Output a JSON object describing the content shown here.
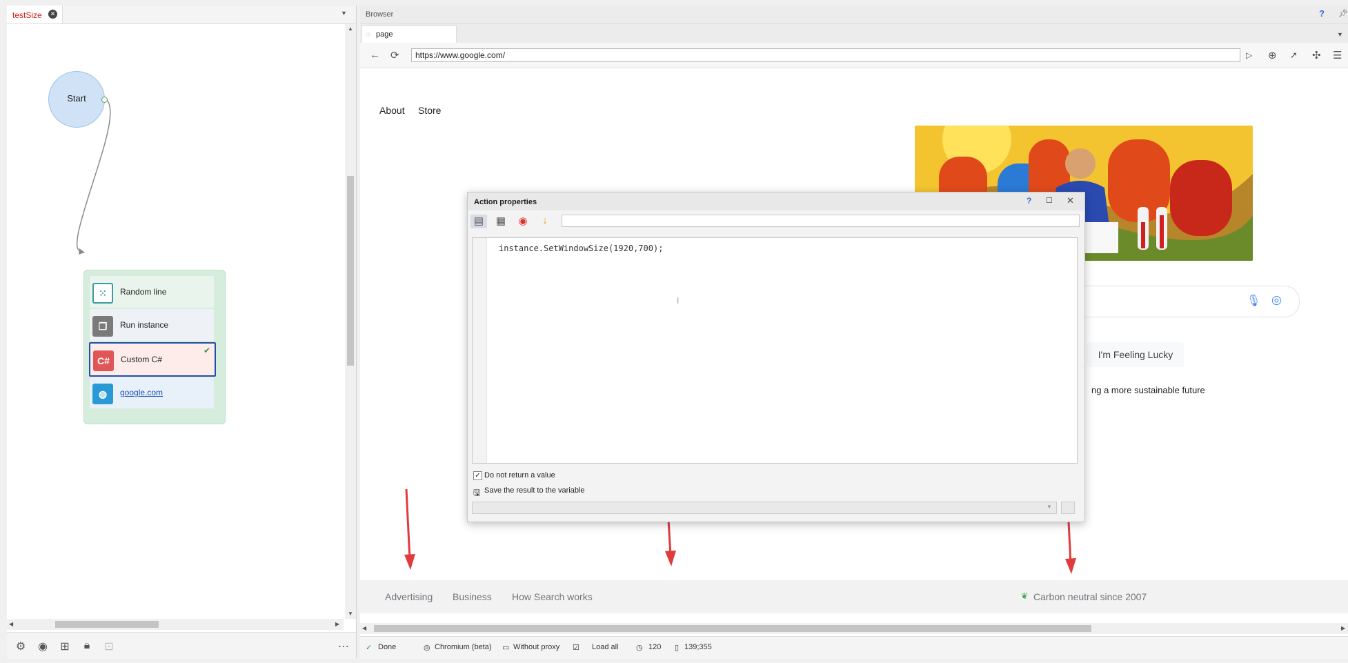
{
  "left_panel": {
    "tab_title": "testSize",
    "nodes": {
      "start": "Start",
      "actions": [
        {
          "label": "Random line",
          "icon": "dice-icon",
          "color": "#3a9aa2"
        },
        {
          "label": "Run instance",
          "icon": "instance-icon",
          "color": "#7a7a7a"
        },
        {
          "label": "Custom C#",
          "icon_text": "C#",
          "color": "#e05555"
        },
        {
          "label": "google.com",
          "icon": "globe-icon",
          "color": "#2a9ad6"
        }
      ]
    }
  },
  "browser": {
    "header_title": "Browser",
    "help_glyph": "?",
    "tab_label": "page",
    "url": "https://www.google.com/"
  },
  "google": {
    "top_links": [
      "About",
      "Store"
    ],
    "lucky_button": "I'm Feeling Lucky",
    "sustain_text": "ng a more sustainable future",
    "footer_links": [
      "Advertising",
      "Business",
      "How Search works"
    ],
    "carbon_text": "Carbon neutral since 2007"
  },
  "dialog": {
    "title": "Action properties",
    "help_glyph": "?",
    "code": "instance.SetWindowSize(1920,700);",
    "checkbox_label": "Do not return a value",
    "save_label": "Save the result to the variable"
  },
  "status": {
    "state": "Done",
    "engine": "Chromium (beta)",
    "proxy": "Without proxy",
    "load": "Load all",
    "timeout": "120",
    "coords": "139;355"
  },
  "colors": {
    "accent_red": "#e03c3c",
    "selected_border": "#1f4fa8"
  }
}
